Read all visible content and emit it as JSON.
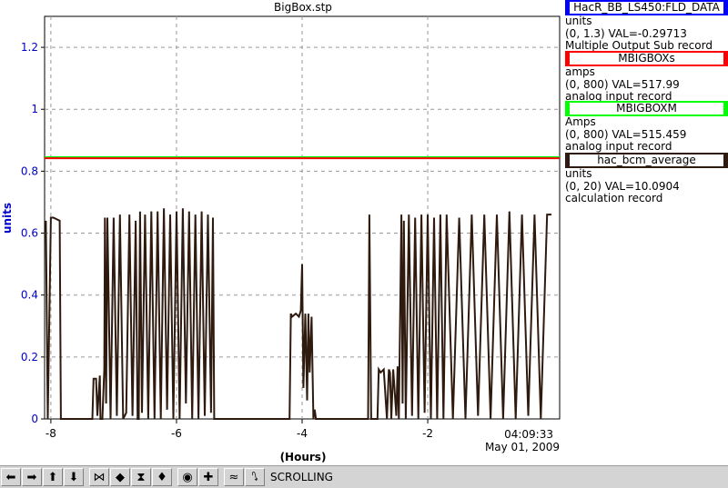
{
  "title": "BigBox.stp",
  "y_axis_label": "units",
  "x_axis_label": "(Hours)",
  "time_label": "04:09:33",
  "date_label": "May 01, 2009",
  "legend": [
    {
      "name": "HacR_BB_LS450:FLD_DATA",
      "color": "#0000ff",
      "units": "units",
      "range_val": "(0, 1.3) VAL=-0.29713",
      "rtype": "Multiple Output Sub record"
    },
    {
      "name": "MBIGBOXs",
      "color": "#ff0000",
      "units": "amps",
      "range_val": "(0, 800) VAL=517.99",
      "rtype": "analog input record"
    },
    {
      "name": "MBIGBOXM",
      "color": "#00ff00",
      "units": "Amps",
      "range_val": "(0, 800) VAL=515.459",
      "rtype": "analog input record"
    },
    {
      "name": "hac_bcm_average",
      "color": "#2e1a0e",
      "units": "units",
      "range_val": "(0, 20) VAL=10.0904",
      "rtype": "calculation record"
    }
  ],
  "toolbar": {
    "mode_label": "SCROLLING",
    "buttons": [
      "arrow-left-icon",
      "arrow-right-icon",
      "arrow-up-icon",
      "arrow-down-icon",
      "zoom-in-x-icon",
      "zoom-out-x-icon",
      "zoom-in-y-icon",
      "zoom-out-y-icon",
      "auto-scale-icon",
      "add-icon",
      "pan-scroll-icon",
      "stop-scroll-icon"
    ],
    "glyphs": [
      "⬅",
      "➡",
      "⬆",
      "⬇",
      "⋈",
      "◆",
      "⧗",
      "♦",
      "◉",
      "✚",
      "≈",
      "⭛"
    ]
  },
  "chart_data": {
    "type": "line",
    "xlabel": "(Hours)",
    "ylabel": "units",
    "xlim": [
      -8.1,
      0.1
    ],
    "ylim": [
      0,
      1.3
    ],
    "x_ticks": [
      -8,
      -6,
      -4,
      -2
    ],
    "y_ticks": [
      0,
      0.2,
      0.4,
      0.6,
      0.8,
      1,
      1.2
    ],
    "grid": true,
    "series": [
      {
        "name": "MBIGBOXM",
        "color": "#00ff00",
        "constant": 0.845
      },
      {
        "name": "MBIGBOXs",
        "color": "#ff0000",
        "constant": 0.842
      },
      {
        "name": "hac_bcm_average",
        "color": "#2e1a0e",
        "x": [
          -8.08,
          -8.05,
          -8.0,
          -7.96,
          -7.86,
          -7.84,
          -7.8,
          -7.78,
          -7.5,
          -7.34,
          -7.32,
          -7.28,
          -7.26,
          -7.22,
          -7.21,
          -7.18,
          -7.15,
          -7.14,
          -7.12,
          -7.1,
          -7.05,
          -7.0,
          -6.95,
          -6.9,
          -6.85,
          -6.8,
          -6.75,
          -6.7,
          -6.65,
          -6.62,
          -6.6,
          -6.58,
          -6.55,
          -6.5,
          -6.45,
          -6.4,
          -6.35,
          -6.3,
          -6.25,
          -6.2,
          -6.15,
          -6.1,
          -6.05,
          -6.0,
          -5.95,
          -5.9,
          -5.85,
          -5.8,
          -5.75,
          -5.7,
          -5.65,
          -5.6,
          -5.55,
          -5.5,
          -5.45,
          -5.42,
          -5.4,
          -4.2,
          -4.18,
          -4.16,
          -4.1,
          -4.05,
          -4.02,
          -4.0,
          -3.98,
          -3.95,
          -3.92,
          -3.9,
          -3.88,
          -3.85,
          -3.82,
          -3.8,
          -3.78,
          -2.95,
          -2.93,
          -2.9,
          -2.88,
          -2.85,
          -2.8,
          -2.78,
          -2.75,
          -2.7,
          -2.65,
          -2.62,
          -2.6,
          -2.58,
          -2.55,
          -2.5,
          -2.48,
          -2.46,
          -2.42,
          -2.4,
          -2.38,
          -2.35,
          -2.3,
          -2.25,
          -2.2,
          -2.15,
          -2.1,
          -2.05,
          -2.0,
          -1.95,
          -1.9,
          -1.85,
          -1.8,
          -1.75,
          -1.7,
          -1.6,
          -1.5,
          -1.4,
          -1.3,
          -1.2,
          -1.1,
          -1.0,
          -0.9,
          -0.8,
          -0.7,
          -0.6,
          -0.5,
          -0.4,
          -0.3,
          -0.2,
          -0.1,
          -0.03
        ],
        "y": [
          0.64,
          0.0,
          0.65,
          0.65,
          0.64,
          0.0,
          0.0,
          0.0,
          0.0,
          0.0,
          0.13,
          0.13,
          0.01,
          0.14,
          0.0,
          0.0,
          0.16,
          0.65,
          0.05,
          0.65,
          0.0,
          0.65,
          0.01,
          0.66,
          0.0,
          0.02,
          0.66,
          0.01,
          0.64,
          0.0,
          0.0,
          0.67,
          0.02,
          0.66,
          0.0,
          0.67,
          0.0,
          0.67,
          0.0,
          0.68,
          0.03,
          0.66,
          0.0,
          0.67,
          0.0,
          0.68,
          0.05,
          0.67,
          0.0,
          0.66,
          0.0,
          0.67,
          0.01,
          0.66,
          0.02,
          0.65,
          0.0,
          0.0,
          0.34,
          0.33,
          0.34,
          0.33,
          0.35,
          0.5,
          0.1,
          0.34,
          0.06,
          0.34,
          0.15,
          0.33,
          0.0,
          0.03,
          0.0,
          0.0,
          0.66,
          0.0,
          0.0,
          0.0,
          0.0,
          0.16,
          0.15,
          0.16,
          0.0,
          0.16,
          0.15,
          0.0,
          0.16,
          0.01,
          0.17,
          0.0,
          0.66,
          0.05,
          0.64,
          0.0,
          0.66,
          0.01,
          0.65,
          0.0,
          0.66,
          0.02,
          0.66,
          0.0,
          0.65,
          0.0,
          0.66,
          0.0,
          0.66,
          0.0,
          0.65,
          0.0,
          0.66,
          0.01,
          0.66,
          0.0,
          0.66,
          0.0,
          0.67,
          0.0,
          0.66,
          0.01,
          0.66,
          0.0,
          0.66,
          0.66
        ]
      }
    ]
  }
}
